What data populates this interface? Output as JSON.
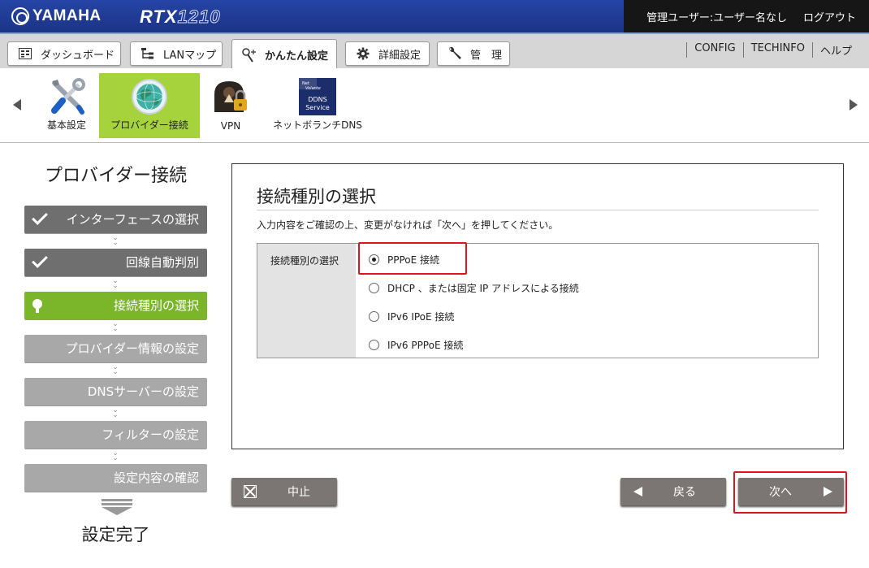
{
  "header": {
    "logo": "YAMAHA",
    "model_prefix": "RTX",
    "model_number": "1210",
    "user_status": "管理ユーザー:ユーザー名なし",
    "logout": "ログアウト"
  },
  "tabs": [
    {
      "label": "ダッシュボード",
      "icon": "dashboard-icon"
    },
    {
      "label": "LANマップ",
      "icon": "lan-map-icon"
    },
    {
      "label": "かんたん設定",
      "icon": "wand-icon"
    },
    {
      "label": "詳細設定",
      "icon": "gear-icon"
    },
    {
      "label": "管　理",
      "icon": "wrench-icon"
    }
  ],
  "top_links": [
    "CONFIG",
    "TECHINFO",
    "ヘルプ"
  ],
  "submenu": [
    {
      "label": "基本設定",
      "icon": "tools-icon"
    },
    {
      "label": "プロバイダー接続",
      "icon": "globe-icon"
    },
    {
      "label": "VPN",
      "icon": "vpn-lock-icon"
    },
    {
      "label": "ネットボランチDNS",
      "icon": "ddns-service-icon"
    }
  ],
  "ddns_icon_text": {
    "l1": "Net",
    "l2": "Volante",
    "l3": "DDNS",
    "l4": "Service"
  },
  "steps": {
    "title": "プロバイダー接続",
    "items": [
      "インターフェースの選択",
      "回線自動判別",
      "接続種別の選択",
      "プロバイダー情報の設定",
      "DNSサーバーの設定",
      "フィルターの設定",
      "設定内容の確認"
    ],
    "done_label": "設定完了"
  },
  "main": {
    "title": "接続種別の選択",
    "description": "入力内容をご確認の上、変更がなければ「次へ」を押してください。",
    "field_label": "接続種別の選択",
    "options": [
      "PPPoE 接続",
      "DHCP 、または固定 IP アドレスによる接続",
      "IPv6 IPoE 接続",
      "IPv6 PPPoE 接続"
    ],
    "selected_index": 0
  },
  "buttons": {
    "cancel": "中止",
    "back": "戻る",
    "next": "次へ"
  },
  "colors": {
    "header_blue": "#2644a6",
    "active_green": "#a6d33b",
    "step_current": "#7ab52a",
    "step_done": "#6f6f6f",
    "step_pending": "#a8a8a8",
    "button_gray": "#7b7574",
    "highlight_red": "#e0141e"
  }
}
